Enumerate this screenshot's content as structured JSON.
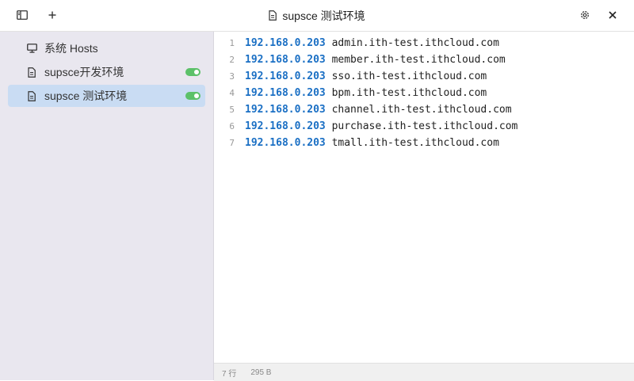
{
  "window": {
    "title": "supsce 测试环境",
    "icons": {
      "sidebar_toggle": "sidebar-toggle-icon",
      "add": "plus-icon",
      "settings": "gear-icon",
      "close": "close-icon",
      "title": "file-icon"
    }
  },
  "sidebar": {
    "items": [
      {
        "label": "系统 Hosts",
        "icon": "monitor-icon",
        "toggle": null,
        "active": false
      },
      {
        "label": "supsce开发环境",
        "icon": "file-icon",
        "toggle": true,
        "active": false
      },
      {
        "label": "supsce 测试环境",
        "icon": "file-icon",
        "toggle": true,
        "active": true
      }
    ]
  },
  "editor": {
    "lines": [
      {
        "num": "1",
        "ip": "192.168.0.203",
        "host": "admin.ith-test.ithcloud.com"
      },
      {
        "num": "2",
        "ip": "192.168.0.203",
        "host": "member.ith-test.ithcloud.com"
      },
      {
        "num": "3",
        "ip": "192.168.0.203",
        "host": "sso.ith-test.ithcloud.com"
      },
      {
        "num": "4",
        "ip": "192.168.0.203",
        "host": "bpm.ith-test.ithcloud.com"
      },
      {
        "num": "5",
        "ip": "192.168.0.203",
        "host": "channel.ith-test.ithcloud.com"
      },
      {
        "num": "6",
        "ip": "192.168.0.203",
        "host": "purchase.ith-test.ithcloud.com"
      },
      {
        "num": "7",
        "ip": "192.168.0.203",
        "host": "tmall.ith-test.ithcloud.com"
      }
    ]
  },
  "status": {
    "lines": "7 行",
    "size": "295 B"
  },
  "colors": {
    "ip": "#1a6fc4",
    "toggle_on": "#5cc169",
    "active_item": "#c9dcf3",
    "sidebar_bg": "#e9e7ef"
  }
}
